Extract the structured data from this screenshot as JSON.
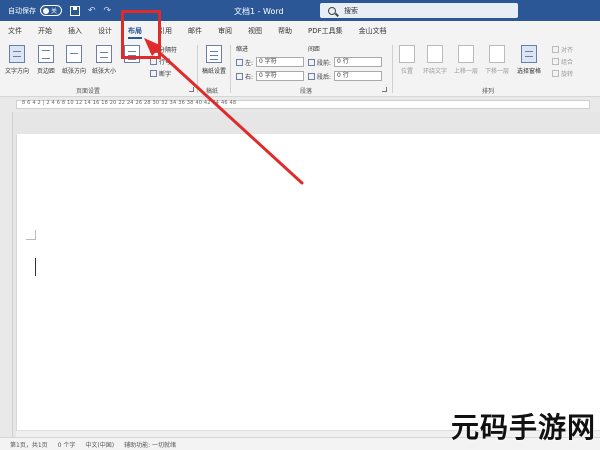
{
  "titlebar": {
    "autosave_label": "自动保存",
    "autosave_state": "关",
    "doc_title": "文档1 - Word",
    "search_label": "搜索",
    "bg_color": "#2b5797"
  },
  "tabs": [
    "文件",
    "开始",
    "插入",
    "设计",
    "布局",
    "引用",
    "邮件",
    "审阅",
    "视图",
    "帮助",
    "PDF工具集",
    "金山文档"
  ],
  "active_tab": "布局",
  "ribbon": {
    "page_setup": {
      "buttons": [
        "文字方向",
        "页边距",
        "纸张方向",
        "纸张大小"
      ],
      "small": [
        "分隔符",
        "行号",
        "断字"
      ],
      "group_label": "页面设置"
    },
    "draft": {
      "button": "稿纸设置",
      "group_label": "稿纸"
    },
    "paragraph": {
      "indent_label": "缩进",
      "spacing_label": "间距",
      "left_label": "左:",
      "right_label": "右:",
      "before_label": "段前:",
      "after_label": "段后:",
      "left_value": "0 字符",
      "right_value": "0 字符",
      "before_value": "0 行",
      "after_value": "0 行",
      "group_label": "段落"
    },
    "arrange": {
      "buttons": [
        "位置",
        "环绕文字",
        "上移一层",
        "下移一层",
        "选择窗格"
      ],
      "small": [
        "对齐",
        "组合",
        "旋转"
      ],
      "group_label": "排列"
    }
  },
  "ruler_numbers": "8 6 4 2 | 2 4 6 8 10 12 14 16 18 20 22 24 26 28 30 32 34 36 38 40 42 44 46 48",
  "status": {
    "page": "第1页，共1页",
    "words": "0 个字",
    "lang": "中文(中国)",
    "accessibility": "辅助功能: 一切就绪"
  },
  "watermark": "元码手游网",
  "colors": {
    "accent": "#2b5797",
    "annotation": "#e02b2b"
  }
}
